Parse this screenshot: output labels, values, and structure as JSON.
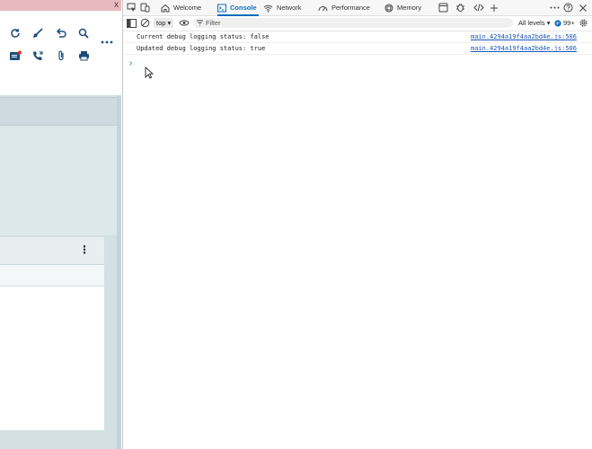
{
  "app": {
    "close_glyph": "x",
    "toolbar_row1": [
      "refresh-icon",
      "brush-icon",
      "undo-icon",
      "search-icon",
      "more-icon"
    ],
    "toolbar_row2": [
      "mail-notification-icon",
      "phone-icon",
      "attachment-icon",
      "print-icon"
    ],
    "card_more_glyph": "⋮"
  },
  "devtools": {
    "tabs": [
      {
        "label": "Welcome",
        "icon": "home-icon",
        "active": false
      },
      {
        "label": "Console",
        "icon": "console-icon",
        "active": true
      },
      {
        "label": "Network",
        "icon": "wifi-icon",
        "active": false
      },
      {
        "label": "Performance",
        "icon": "performance-icon",
        "active": false
      },
      {
        "label": "Memory",
        "icon": "memory-icon",
        "active": false
      }
    ],
    "filterbar": {
      "context": "top",
      "filter_placeholder": "Filter",
      "levels": "All levels",
      "issues_count": "99+"
    },
    "console": {
      "messages": [
        {
          "text": "Current debug logging status: false",
          "source": "main.4294a19f4aa2bd4e.js:506"
        },
        {
          "text": "Updated debug logging status: true",
          "source": "main.4294a19f4aa2bd4e.js:506"
        }
      ],
      "prompt_glyph": "›"
    }
  },
  "colors": {
    "accent": "#0f6cbd",
    "app_background": "#d3e0e4",
    "app_titlebar": "#e9b9c0",
    "link": "#1a56b3"
  }
}
